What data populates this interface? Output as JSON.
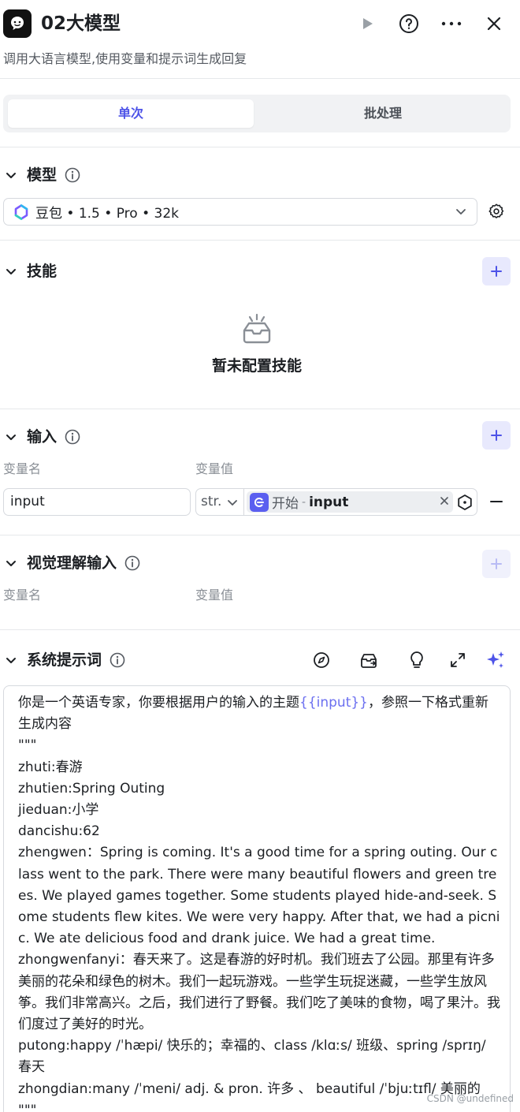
{
  "header": {
    "title": "02大模型",
    "description": "调用大语言模型,使用变量和提示词生成回复"
  },
  "tabs": [
    {
      "label": "单次",
      "active": true
    },
    {
      "label": "批处理",
      "active": false
    }
  ],
  "model": {
    "title": "模型",
    "selected": "豆包 • 1.5 • Pro • 32k"
  },
  "skills": {
    "title": "技能",
    "empty_text": "暂未配置技能"
  },
  "input": {
    "title": "输入",
    "col_name": "变量名",
    "col_value": "变量值",
    "rows": [
      {
        "name": "input",
        "type": "str.",
        "ref_node": "开始",
        "ref_separator": "-",
        "ref_var": "input"
      }
    ]
  },
  "visual_input": {
    "title": "视觉理解输入",
    "col_name": "变量名",
    "col_value": "变量值"
  },
  "system_prompt": {
    "title": "系统提示词",
    "intro_before": "你是一个英语专家，你要根据用户的输入的主题",
    "intro_var": "{{input}}",
    "intro_after": "，参照一下格式重新生成内容",
    "lines": [
      "\"\"\"",
      "zhuti:春游",
      "zhutien:Spring Outing",
      "jieduan:小学",
      "dancishu:62",
      "zhengwen：Spring is coming. It's a good time for a spring outing. Our class went to the park. There were many beautiful flowers and green trees. We played games together. Some students played hide-and-seek. Some students flew kites. We were very happy. After that, we had a picnic. We ate delicious food and drank juice. We had a great time.",
      "zhongwenfanyi：春天来了。这是春游的好时机。我们班去了公园。那里有许多美丽的花朵和绿色的树木。我们一起玩游戏。一些学生玩捉迷藏，一些学生放风筝。我们非常高兴。之后，我们进行了野餐。我们吃了美味的食物，喝了果汁。我们度过了美好的时光。",
      "putong:happy /ˈhæpi/ 快乐的；幸福的、class /klɑːs/ 班级、spring /sprɪŋ/ 春天",
      "zhongdian:many /ˈmeni/ adj. & pron. 许多 、 beautiful /ˈbjuːtɪfl/ 美丽的",
      "\"\"\""
    ]
  },
  "watermark": "CSDN @undefined",
  "colors": {
    "accent": "#4d53e8",
    "accent_bg": "#e8e9fd",
    "border": "#d6d9de"
  }
}
